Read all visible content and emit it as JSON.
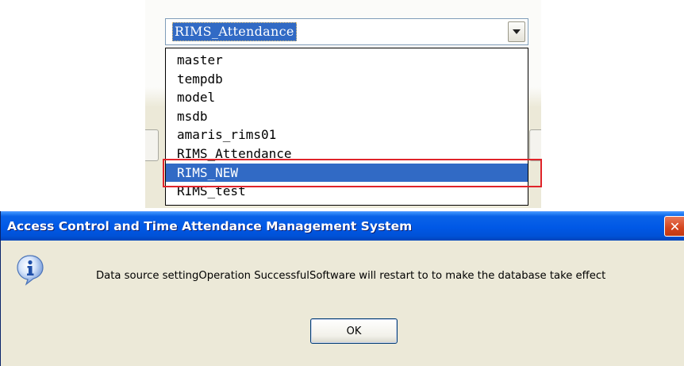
{
  "combo": {
    "selected_value": "RIMS_Attendance"
  },
  "dropdown": {
    "options": [
      "master",
      "tempdb",
      "model",
      "msdb",
      "amaris_rims01",
      "RIMS_Attendance",
      "RIMS_NEW",
      "RIMS_test"
    ],
    "highlighted_index": 6,
    "highlight_color": "#316ac5",
    "annotation_color": "#e0242a"
  },
  "dialog": {
    "title": "Access Control and Time Attendance Management System",
    "message": "Data source settingOperation SuccessfulSoftware will restart to to make the database take effect",
    "ok_label": "OK",
    "close_glyph": "✕",
    "icon": "information-icon",
    "titlebar_color": "#0058e6"
  }
}
